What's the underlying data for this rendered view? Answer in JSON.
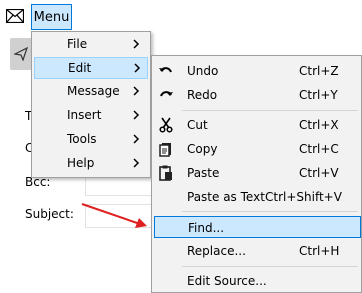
{
  "menubar": {
    "mail_icon": "envelope-icon",
    "menu_label": "Menu"
  },
  "form": {
    "labels": [
      "T",
      "C",
      "Bcc:",
      "Subject:"
    ]
  },
  "main_menu": {
    "items": [
      {
        "label": "File",
        "has_submenu": true
      },
      {
        "label": "Edit",
        "has_submenu": true,
        "selected": true
      },
      {
        "label": "Message",
        "has_submenu": true
      },
      {
        "label": "Insert",
        "has_submenu": true
      },
      {
        "label": "Tools",
        "has_submenu": true
      },
      {
        "label": "Help",
        "has_submenu": true
      }
    ]
  },
  "edit_menu": {
    "items": [
      {
        "label": "Undo",
        "shortcut": "Ctrl+Z",
        "icon": "undo-icon"
      },
      {
        "label": "Redo",
        "shortcut": "Ctrl+Y",
        "icon": "redo-icon"
      },
      {
        "label": "Cut",
        "shortcut": "Ctrl+X",
        "icon": "scissors-icon"
      },
      {
        "label": "Copy",
        "shortcut": "Ctrl+C",
        "icon": "copy-icon"
      },
      {
        "label": "Paste",
        "shortcut": "Ctrl+V",
        "icon": "paste-icon"
      },
      {
        "label": "Paste as Text",
        "shortcut": "Ctrl+Shift+V"
      },
      {
        "label": "Find...",
        "shortcut": "",
        "selected": true
      },
      {
        "label": "Replace...",
        "shortcut": "Ctrl+H"
      },
      {
        "label": "Edit Source...",
        "shortcut": ""
      }
    ]
  },
  "colors": {
    "highlight": "#cce8ff",
    "highlight_border": "#0078d7",
    "menu_bg": "#f2f2f2",
    "annotation_arrow": "#e02020"
  }
}
